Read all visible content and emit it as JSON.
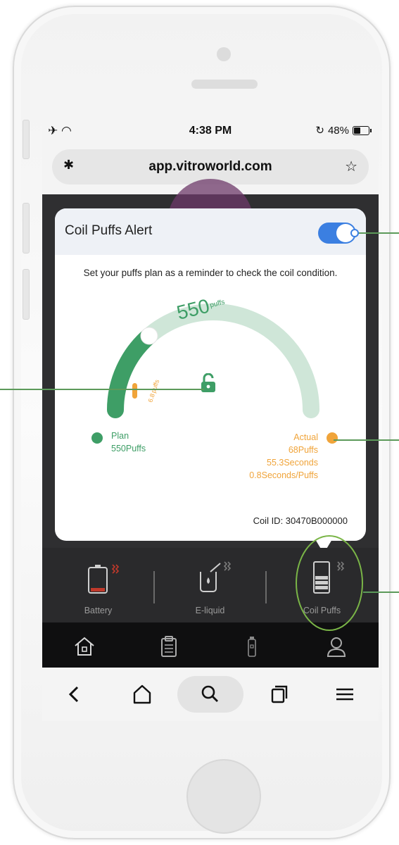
{
  "status_bar": {
    "left_icons": "✈ ◠",
    "time": "4:38 PM",
    "battery_percent": "48%",
    "battery_level": 0.48
  },
  "browser": {
    "url": "app.vitroworld.com"
  },
  "modal": {
    "title": "Coil Puffs Alert",
    "toggle_on": true,
    "description": "Set your puffs plan as a reminder to check the coil condition.",
    "gauge": {
      "plan_value": "550",
      "plan_unit": "puffs",
      "actual_value": "6.8",
      "actual_unit": "puffs"
    },
    "plan": {
      "label": "Plan",
      "value": "550Puffs"
    },
    "actual": {
      "label": "Actual",
      "puffs": "68Puffs",
      "seconds": "55.3Seconds",
      "rate": "0.8Seconds/Puffs"
    },
    "coil_id": "Coil ID: 30470B000000"
  },
  "tabs": [
    {
      "label": "Battery",
      "icon": "battery-icon"
    },
    {
      "label": "E-liquid",
      "icon": "e-liquid-icon"
    },
    {
      "label": "Coil Puffs",
      "icon": "coil-icon",
      "selected": true
    }
  ],
  "app_nav": [
    "home-icon",
    "clipboard-icon",
    "device-icon",
    "profile-icon"
  ],
  "browser_nav": [
    "back-icon",
    "home-icon",
    "search-icon",
    "tabs-icon",
    "menu-icon"
  ],
  "colors": {
    "green": "#3e9e66",
    "light_green": "#cfe6d8",
    "orange": "#f0a43a",
    "toggle_blue": "#3b7fe1",
    "callout_line": "#5c9a5a",
    "highlight": "#7ab547"
  }
}
